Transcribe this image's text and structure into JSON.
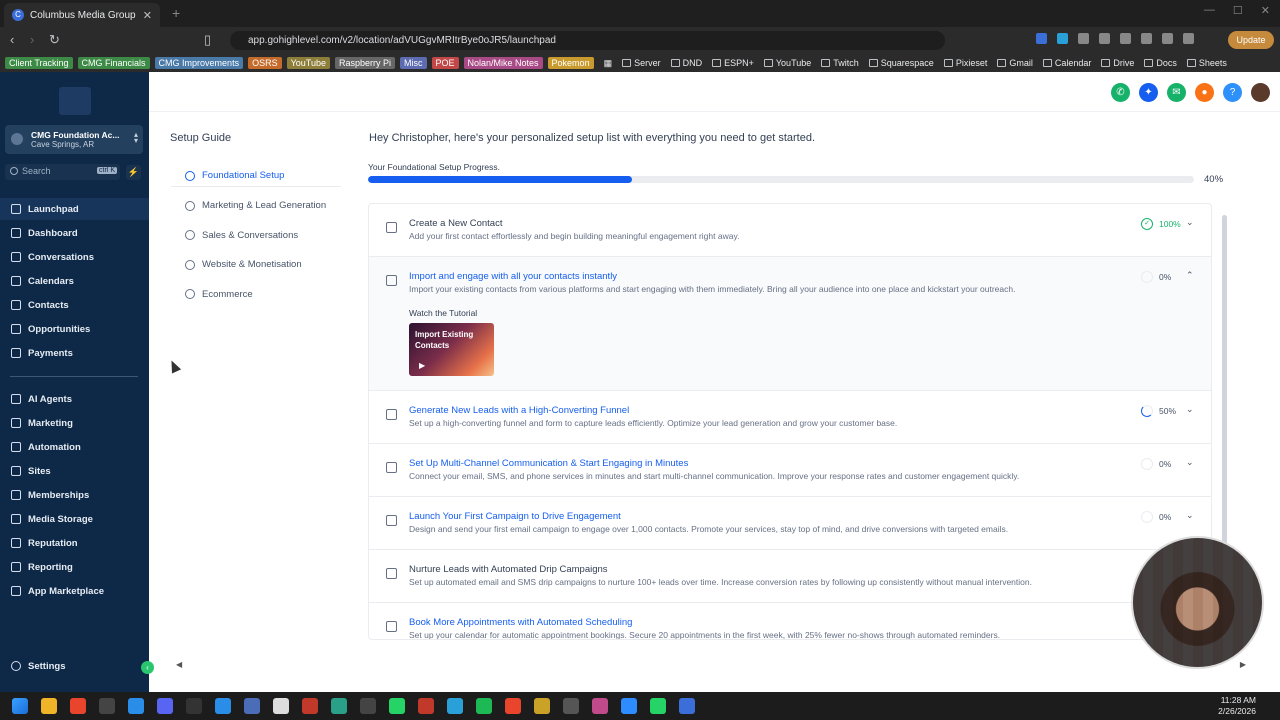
{
  "browser": {
    "tab_title": "Columbus Media Group",
    "url": "app.gohighlevel.com/v2/location/adVUGgvMRItrBye0oJR5/launchpad",
    "update_label": "Update",
    "bookmark_chips": [
      {
        "label": "Client Tracking",
        "color": "#3c8a45"
      },
      {
        "label": "CMG Financials",
        "color": "#3c8a45"
      },
      {
        "label": "CMG Improvements",
        "color": "#4a7aa8"
      },
      {
        "label": "OSRS",
        "color": "#c46a2b"
      },
      {
        "label": "YouTube",
        "color": "#8d7e3a"
      },
      {
        "label": "Raspberry Pi",
        "color": "#666"
      },
      {
        "label": "Misc",
        "color": "#5d6bb0"
      },
      {
        "label": "POE",
        "color": "#c24848"
      },
      {
        "label": "Nolan/Mike Notes",
        "color": "#a84a86"
      },
      {
        "label": "Pokemon",
        "color": "#c99b2e"
      }
    ],
    "bookmarks": [
      "Server",
      "DND",
      "ESPN+",
      "YouTube",
      "Twitch",
      "Squarespace",
      "Pixieset",
      "Gmail",
      "Calendar",
      "Drive",
      "Docs",
      "Sheets"
    ]
  },
  "sidebar": {
    "account_name": "CMG Foundation Ac...",
    "account_location": "Cave Springs, AR",
    "search_placeholder": "Search",
    "search_shortcut": "ctrl K",
    "nav_primary": [
      {
        "label": "Launchpad",
        "icon": "rocket-icon"
      },
      {
        "label": "Dashboard",
        "icon": "dashboard-icon"
      },
      {
        "label": "Conversations",
        "icon": "chat-icon"
      },
      {
        "label": "Calendars",
        "icon": "calendar-icon"
      },
      {
        "label": "Contacts",
        "icon": "contacts-icon"
      },
      {
        "label": "Opportunities",
        "icon": "opportunities-icon"
      },
      {
        "label": "Payments",
        "icon": "payments-icon"
      }
    ],
    "nav_secondary": [
      {
        "label": "AI Agents",
        "icon": "ai-icon"
      },
      {
        "label": "Marketing",
        "icon": "marketing-icon"
      },
      {
        "label": "Automation",
        "icon": "automation-icon"
      },
      {
        "label": "Sites",
        "icon": "sites-icon"
      },
      {
        "label": "Memberships",
        "icon": "memberships-icon"
      },
      {
        "label": "Media Storage",
        "icon": "media-icon"
      },
      {
        "label": "Reputation",
        "icon": "reputation-icon"
      },
      {
        "label": "Reporting",
        "icon": "reporting-icon"
      },
      {
        "label": "App Marketplace",
        "icon": "marketplace-icon"
      }
    ],
    "settings_label": "Settings"
  },
  "setup_guide": {
    "title": "Setup Guide",
    "items": [
      {
        "label": "Foundational Setup",
        "active": true
      },
      {
        "label": "Marketing & Lead Generation",
        "active": false
      },
      {
        "label": "Sales & Conversations",
        "active": false
      },
      {
        "label": "Website & Monetisation",
        "active": false
      },
      {
        "label": "Ecommerce",
        "active": false
      }
    ]
  },
  "main": {
    "greeting": "Hey Christopher, here's your personalized setup list with everything you need to get started.",
    "progress_label": "Your Foundational Setup Progress.",
    "progress_value": 0.4,
    "progress_text": "40%"
  },
  "tasks": [
    {
      "title": "Create a New Contact",
      "desc": "Add your first contact effortlessly and begin building meaningful engagement right away.",
      "pct": "100%",
      "status": "done"
    },
    {
      "title": "Import and engage with all your contacts instantly",
      "desc": "Import your existing contacts from various platforms and start engaging with them immediately. Bring all your audience into one place and kickstart your outreach.",
      "pct": "0%",
      "status": "none",
      "tutorial_label": "Watch the Tutorial",
      "tutorial_title": "Import Existing Contacts"
    },
    {
      "title": "Generate New Leads with a High-Converting Funnel",
      "desc": "Set up a high-converting funnel and form to capture leads efficiently. Optimize your lead generation and grow your customer base.",
      "pct": "50%",
      "status": "half"
    },
    {
      "title": "Set Up Multi-Channel Communication & Start Engaging in Minutes",
      "desc": "Connect your email, SMS, and phone services in minutes and start multi-channel communication. Improve your response rates and customer engagement quickly.",
      "pct": "0%",
      "status": "none"
    },
    {
      "title": "Launch Your First Campaign to Drive Engagement",
      "desc": "Design and send your first email campaign to engage over 1,000 contacts. Promote your services, stay top of mind, and drive conversions with targeted emails.",
      "pct": "0%",
      "status": "none"
    },
    {
      "title": "Nurture Leads with Automated Drip Campaigns",
      "desc": "Set up automated email and SMS drip campaigns to nurture 100+ leads over time. Increase conversion rates by following up consistently without manual intervention.",
      "pct": "",
      "status": "none"
    },
    {
      "title": "Book More Appointments with Automated Scheduling",
      "desc": "Set up your calendar for automatic appointment bookings. Secure 20 appointments in the first week, with 25% fewer no-shows through automated reminders.",
      "pct": "",
      "status": "none"
    }
  ],
  "taskbar": {
    "time": "11:28 AM",
    "date": "2/26/2026"
  }
}
